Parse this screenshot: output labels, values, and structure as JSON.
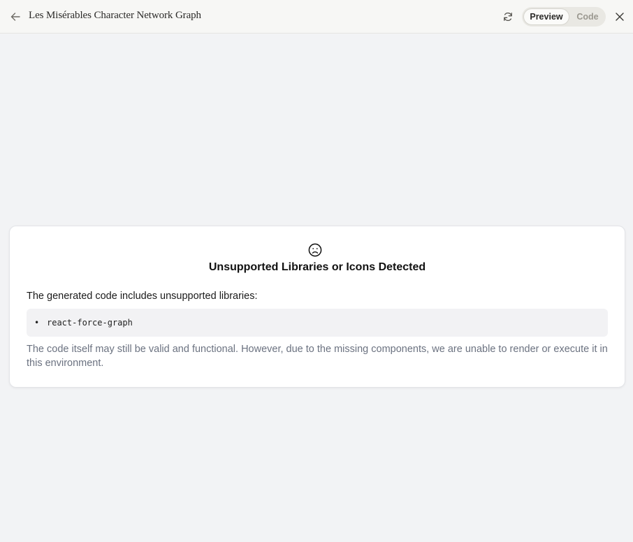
{
  "header": {
    "title": "Les Misérables Character Network Graph",
    "toggle": {
      "preview_label": "Preview",
      "code_label": "Code",
      "active": "Preview"
    },
    "icons": {
      "back": "arrow-left-icon",
      "refresh": "refresh-icon",
      "close": "close-icon"
    }
  },
  "error_card": {
    "icon": "frown-icon",
    "title": "Unsupported Libraries or Icons Detected",
    "intro": "The generated code includes unsupported libraries:",
    "libraries": [
      "react-force-graph"
    ],
    "note": "The code itself may still be valid and functional. However, due to the missing components, we are unable to render or execute it in this environment."
  },
  "colors": {
    "background": "#f2f3f5",
    "topbar": "#f7f7f5",
    "note_text": "#6b7280"
  }
}
